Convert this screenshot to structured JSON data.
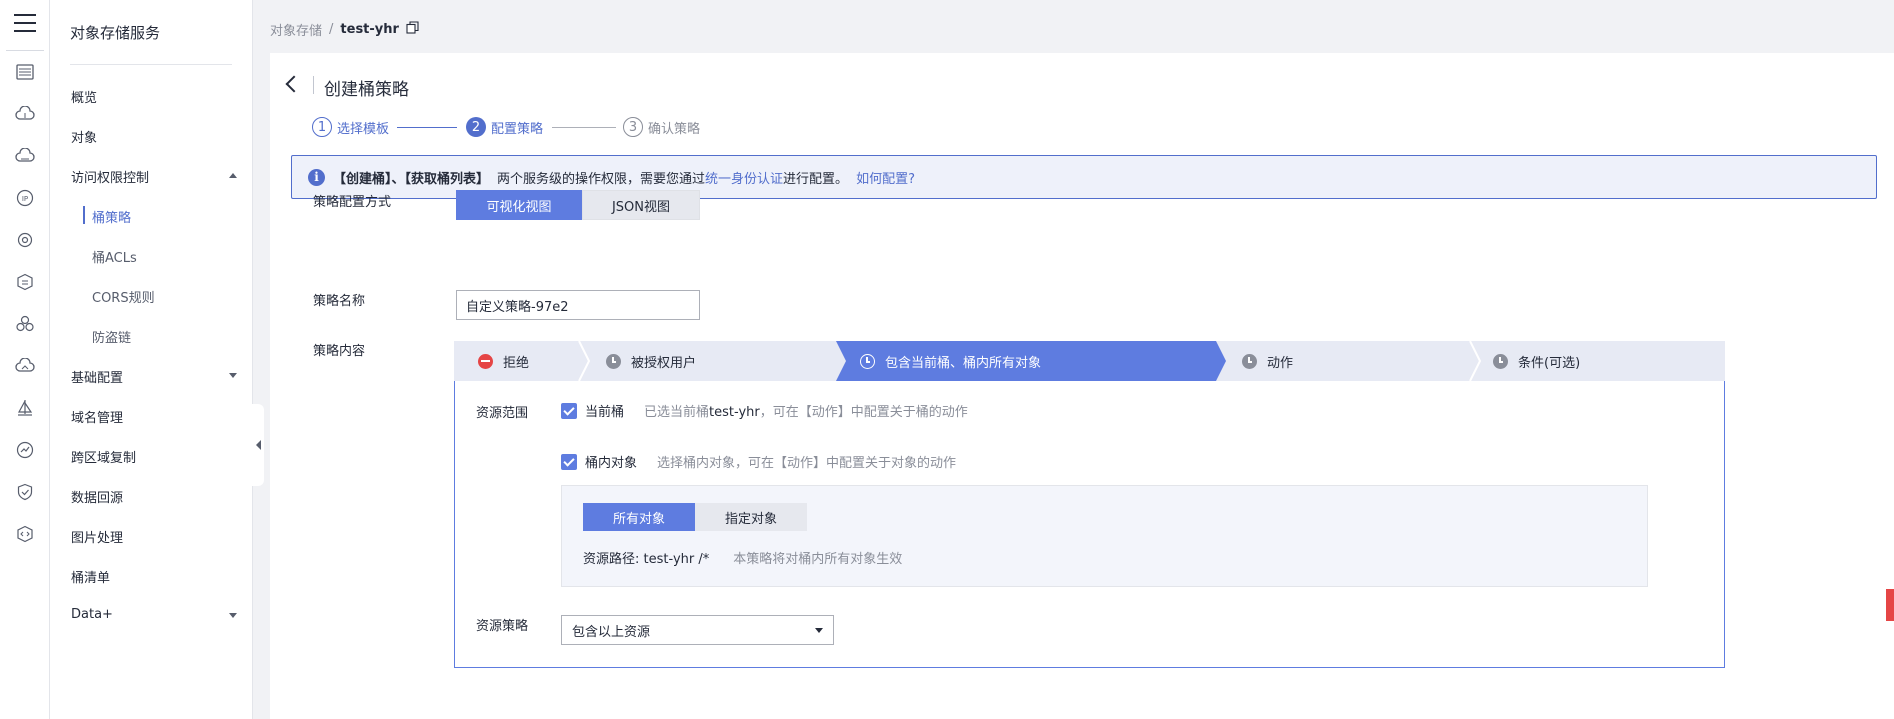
{
  "side_menu": {
    "title": "对象存储服务",
    "items": [
      {
        "label": "概览"
      },
      {
        "label": "对象"
      },
      {
        "label": "访问权限控制"
      },
      {
        "label": "桶策略"
      },
      {
        "label": "桶ACLs"
      },
      {
        "label": "CORS规则"
      },
      {
        "label": "防盗链"
      },
      {
        "label": "基础配置"
      },
      {
        "label": "域名管理"
      },
      {
        "label": "跨区域复制"
      },
      {
        "label": "数据回源"
      },
      {
        "label": "图片处理"
      },
      {
        "label": "桶清单"
      },
      {
        "label": "Data+"
      }
    ]
  },
  "breadcrumb": {
    "root": "对象存储",
    "separator": "/",
    "current": "test-yhr"
  },
  "page": {
    "title": "创建桶策略"
  },
  "steps": [
    {
      "num": "1",
      "label": "选择模板",
      "state": "done"
    },
    {
      "num": "2",
      "label": "配置策略",
      "state": "current"
    },
    {
      "num": "3",
      "label": "确认策略",
      "state": "todo"
    }
  ],
  "info": {
    "bold": "【创建桶】、【获取桶列表】",
    "text": "两个服务级的操作权限，需要您通过",
    "link1": "统一身份认证",
    "text2": "进行配置。",
    "link2": "如何配置?"
  },
  "form": {
    "mode_label": "策略配置方式",
    "mode_visual": "可视化视图",
    "mode_json": "JSON视图",
    "name_label": "策略名称",
    "name_value": "自定义策略-97e2",
    "content_label": "策略内容"
  },
  "tabs": [
    {
      "label": "拒绝"
    },
    {
      "label": "被授权用户"
    },
    {
      "label": "包含当前桶、桶内所有对象"
    },
    {
      "label": "动作"
    },
    {
      "label": "条件(可选)"
    }
  ],
  "panel": {
    "scope_label": "资源范围",
    "current_bucket": "当前桶",
    "current_bucket_hint_pre": "已选当前桶",
    "current_bucket_hint_bucket": "test-yhr",
    "current_bucket_hint_post": "，可在【动作】中配置关于桶的动作",
    "objects": "桶内对象",
    "objects_hint": "选择桶内对象，可在【动作】中配置关于对象的动作",
    "all_objects": "所有对象",
    "specific_objects": "指定对象",
    "resource_path": "资源路径: test-yhr /*",
    "resource_path_hint": "本策略将对桶内所有对象生效",
    "policy_label": "资源策略",
    "policy_value": "包含以上资源"
  },
  "colors": {
    "accent": "#5e7ce0",
    "link": "#526ecc",
    "deny": "#e54545"
  }
}
